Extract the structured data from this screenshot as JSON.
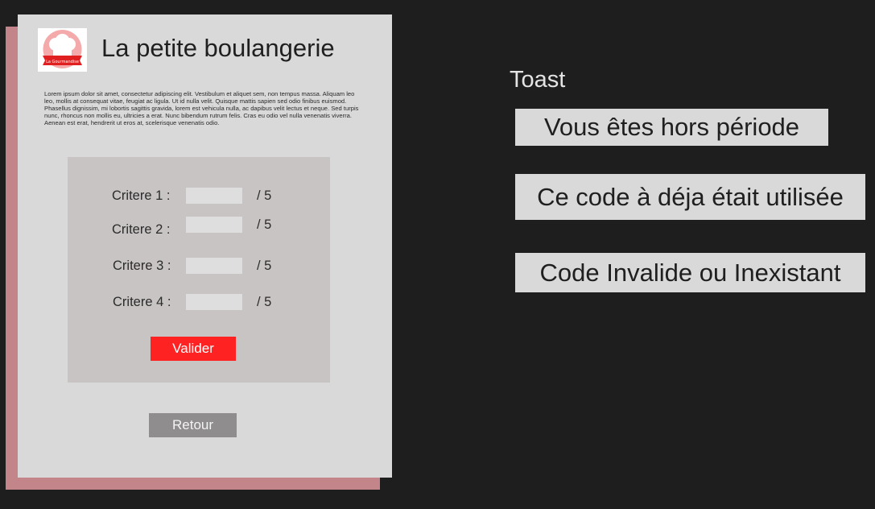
{
  "app": {
    "title": "La petite boulangerie",
    "logo_text": "La Gourmandise",
    "description": "Lorem ipsum dolor sit amet, consectetur adipiscing elit. Vestibulum et aliquet sem, non tempus massa. Aliquam leo leo, mollis at consequat vitae, feugiat ac ligula. Ut id nulla velit. Quisque mattis sapien sed odio finibus euismod. Phasellus dignissim, mi lobortis sagittis gravida, lorem est vehicula nulla, ac dapibus velit lectus et neque. Sed turpis nunc, rhoncus non mollis eu, ultricies a erat. Nunc bibendum rutrum felis. Cras eu odio vel nulla venenatis viverra. Aenean est erat, hendrerit ut eros at, scelerisque venenatis odio."
  },
  "form": {
    "criteria": [
      {
        "label": "Critere 1 :",
        "value": "",
        "max": "/ 5"
      },
      {
        "label": "Critere 2 :",
        "value": "",
        "max": "/ 5"
      },
      {
        "label": "Critere 3 :",
        "value": "",
        "max": "/ 5"
      },
      {
        "label": "Critere 4 :",
        "value": "",
        "max": "/ 5"
      }
    ],
    "submit_label": "Valider"
  },
  "back_label": "Retour",
  "toasts": {
    "heading": "Toast",
    "messages": [
      "Vous êtes hors période",
      "Ce code à déja était utilisée",
      "Code Invalide ou Inexistant"
    ]
  },
  "colors": {
    "background": "#1e1e1e",
    "card": "#d9d9d9",
    "card_shadow": "#c4858a",
    "panel": "#c8c4c4",
    "accent": "#ff2222",
    "secondary_button": "#8f8d8d"
  }
}
